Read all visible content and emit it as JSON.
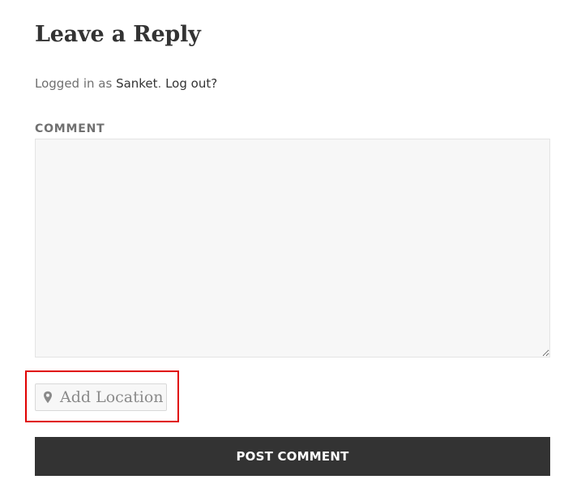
{
  "reply": {
    "title": "Leave a Reply",
    "logged_prefix": "Logged in as ",
    "user_name": "Sanket",
    "separator": ". ",
    "logout_label": "Log out?"
  },
  "comment": {
    "label": "COMMENT",
    "value": ""
  },
  "location": {
    "icon": "map-pin-icon",
    "label": "Add Location"
  },
  "actions": {
    "post_label": "POST COMMENT"
  },
  "colors": {
    "highlight": "#e00000",
    "button_bg": "#333333"
  }
}
